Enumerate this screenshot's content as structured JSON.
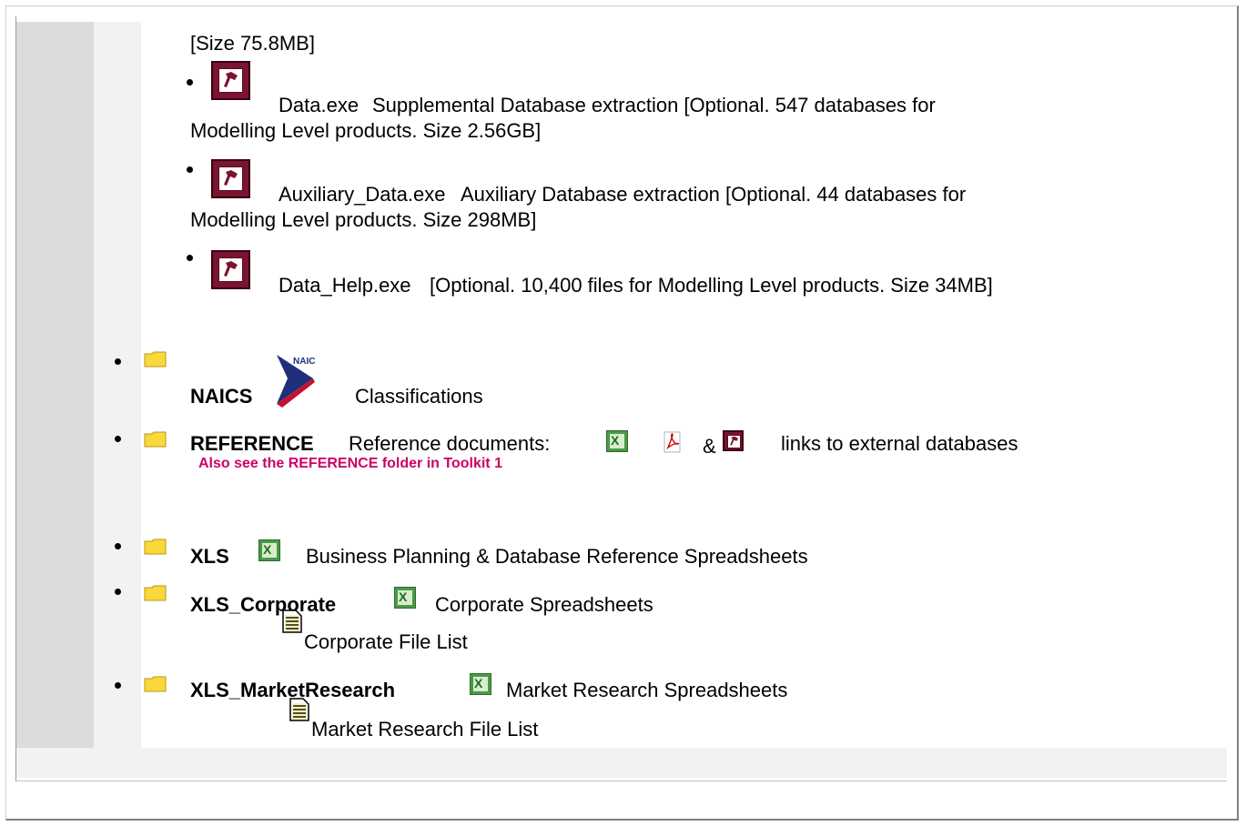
{
  "section_prefix_size": "[Size 75.8MB]",
  "downloads": [
    {
      "file": "Data.exe",
      "desc_line1": "Supplemental Database extraction [Optional. 547 databases for",
      "desc_line2": "Modelling Level products. Size 2.56GB]",
      "icon": "access-key-icon"
    },
    {
      "file": "Auxiliary_Data.exe",
      "desc_line1": "Auxiliary Database extraction [Optional. 44 databases for",
      "desc_line2": "Modelling Level products. Size 298MB]",
      "icon": "access-key-icon"
    },
    {
      "file": "Data_Help.exe",
      "desc_line1": "[Optional. 10,400 files for Modelling Level products. Size 34MB]",
      "icon": "access-key-icon"
    }
  ],
  "folders": {
    "naics": {
      "name": "NAICS",
      "logo_text": "NAICS",
      "desc": "Classifications"
    },
    "reference": {
      "name": "REFERENCE",
      "desc_before": "Reference documents:",
      "amp": "&",
      "desc_after": "links to external databases",
      "note": "Also see the REFERENCE folder in Toolkit 1"
    },
    "xls": {
      "name": "XLS",
      "desc": "Business Planning & Database Reference Spreadsheets"
    },
    "xls_corporate": {
      "name": "XLS_Corporate",
      "desc": "Corporate Spreadsheets",
      "file_list": "Corporate File List"
    },
    "xls_marketresearch": {
      "name": "XLS_MarketResearch",
      "desc": "Market Research Spreadsheets",
      "file_list": "Market Research File List"
    }
  },
  "icon_glyphs": {
    "xls": "X"
  },
  "colors": {
    "note_pink": "#cc0066",
    "access_red": "#7a1431",
    "folder_yellow": "#f8d83a",
    "excel_green": "#4a9a48"
  }
}
